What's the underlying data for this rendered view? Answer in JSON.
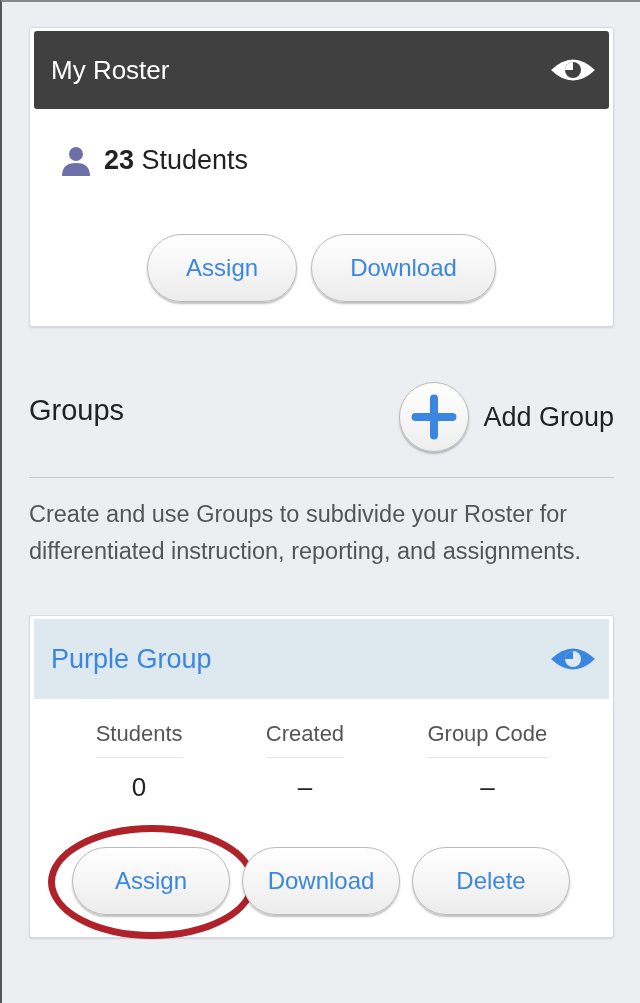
{
  "roster": {
    "title": "My Roster",
    "count": "23",
    "count_label": "Students",
    "buttons": [
      {
        "label": "Assign",
        "highlighted": false
      },
      {
        "label": "Download",
        "highlighted": false
      }
    ]
  },
  "groups": {
    "title": "Groups",
    "add_label": "Add Group",
    "description": "Create and use Groups to subdivide your Roster for differentiated instruction, reporting, and assignments.",
    "items": [
      {
        "name": "Purple Group",
        "columns": [
          {
            "label": "Students",
            "value": "0"
          },
          {
            "label": "Created",
            "value": "–"
          },
          {
            "label": "Group Code",
            "value": "–"
          }
        ],
        "buttons": [
          {
            "label": "Assign",
            "highlighted": true
          },
          {
            "label": "Download",
            "highlighted": false
          },
          {
            "label": "Delete",
            "highlighted": false
          }
        ]
      }
    ]
  }
}
